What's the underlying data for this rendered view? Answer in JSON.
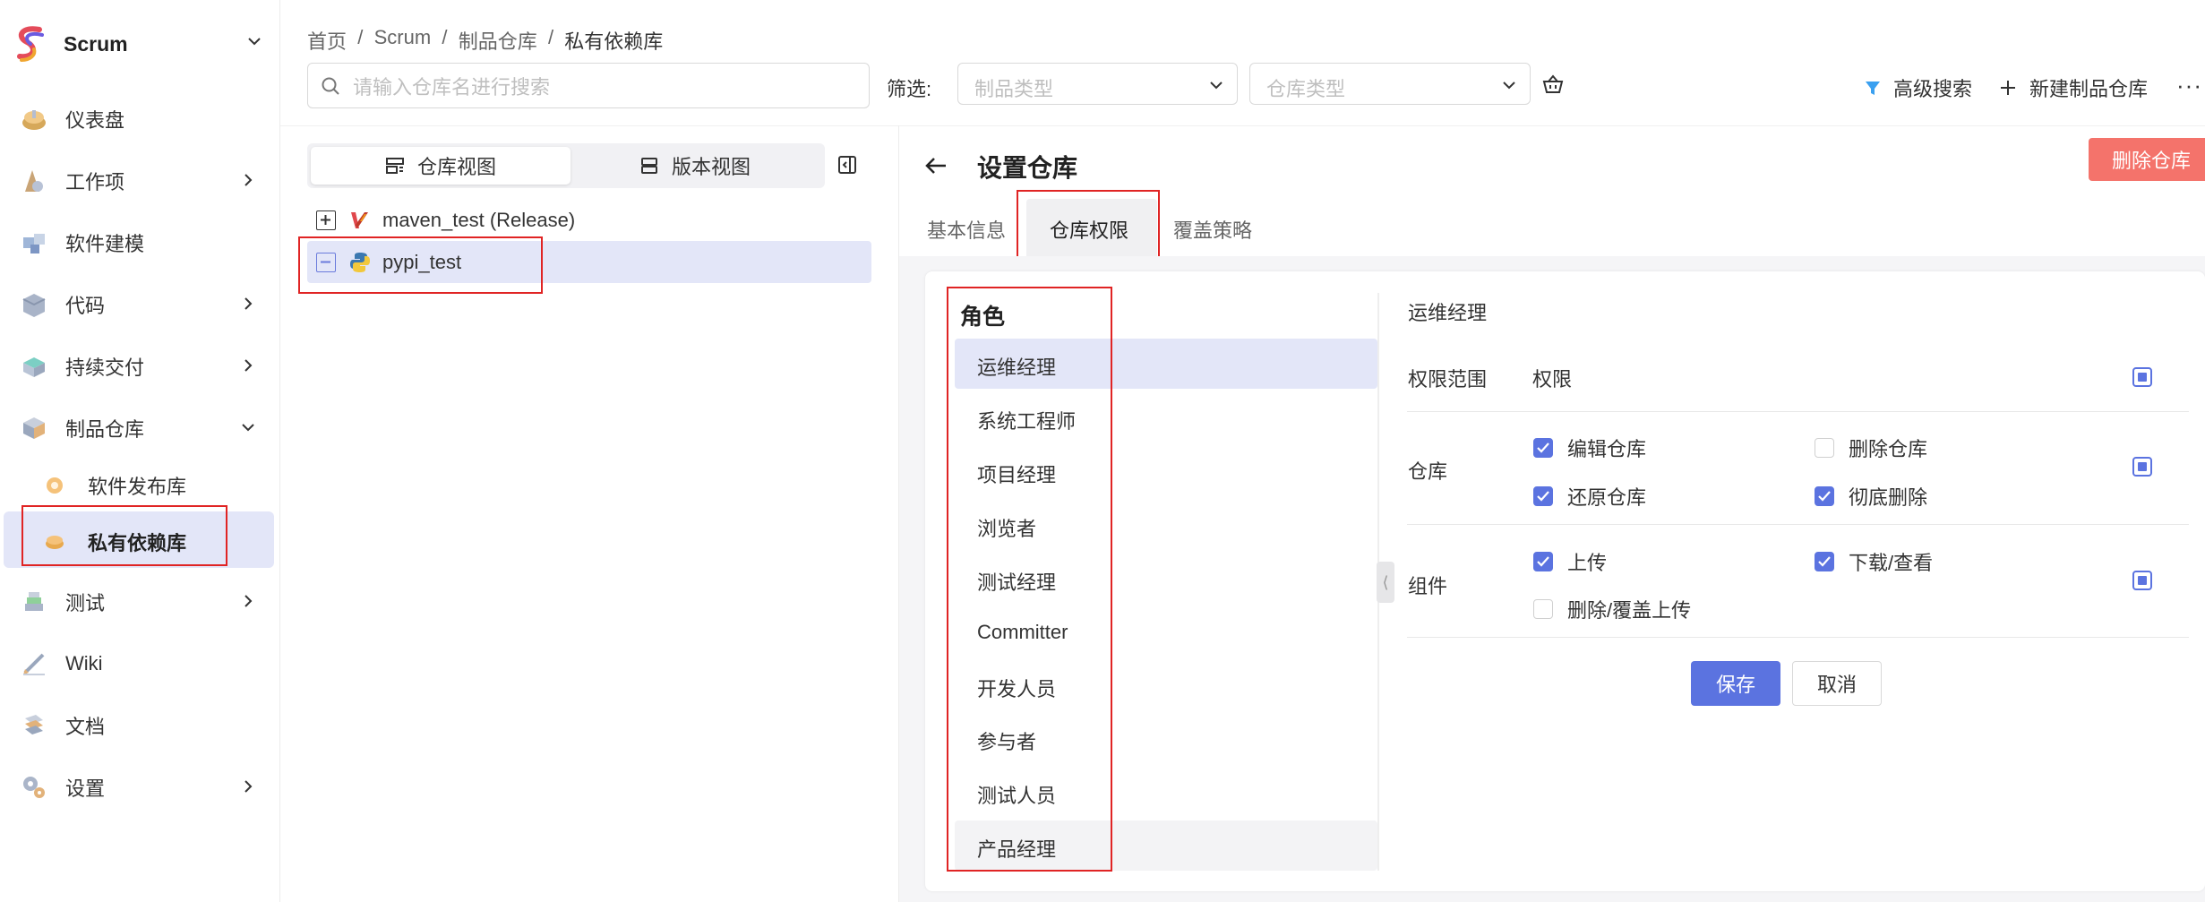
{
  "app": {
    "name": "Scrum"
  },
  "sidebar": {
    "items": [
      {
        "label": "仪表盘",
        "icon": "dashboard-icon"
      },
      {
        "label": "工作项",
        "icon": "workitem-icon"
      },
      {
        "label": "软件建模",
        "icon": "modeling-icon"
      },
      {
        "label": "代码",
        "icon": "code-icon"
      },
      {
        "label": "持续交付",
        "icon": "delivery-icon"
      },
      {
        "label": "制品仓库",
        "icon": "artifact-repo-icon"
      },
      {
        "label": "测试",
        "icon": "test-icon"
      },
      {
        "label": "Wiki",
        "icon": "wiki-icon"
      },
      {
        "label": "文档",
        "icon": "docs-icon"
      },
      {
        "label": "设置",
        "icon": "settings-icon"
      }
    ],
    "subitems": [
      {
        "label": "软件发布库"
      },
      {
        "label": "私有依赖库"
      }
    ]
  },
  "breadcrumb": [
    "首页",
    "Scrum",
    "制品仓库",
    "私有依赖库"
  ],
  "search": {
    "placeholder": "请输入仓库名进行搜索"
  },
  "filter": {
    "label": "筛选:",
    "artifact_type_placeholder": "制品类型",
    "repo_type_placeholder": "仓库类型"
  },
  "toolbar": {
    "advanced_search": "高级搜索",
    "new_repo": "新建制品仓库",
    "more": "···"
  },
  "view_switch": {
    "repo_view": "仓库视图",
    "version_view": "版本视图"
  },
  "tree": {
    "rows": [
      {
        "label": "maven_test (Release)"
      },
      {
        "label": "pypi_test"
      }
    ]
  },
  "detail": {
    "title": "设置仓库",
    "delete_button": "删除仓库",
    "tabs": [
      "基本信息",
      "仓库权限",
      "覆盖策略"
    ],
    "active_tab": "仓库权限"
  },
  "roles": {
    "header": "角色",
    "items": [
      "运维经理",
      "系统工程师",
      "项目经理",
      "浏览者",
      "测试经理",
      "Committer",
      "开发人员",
      "参与者",
      "测试人员",
      "产品经理"
    ],
    "selected": "运维经理"
  },
  "permissions": {
    "role_title": "运维经理",
    "scope_label": "权限范围",
    "perm_label": "权限",
    "groups": [
      {
        "name": "仓库",
        "options": [
          {
            "label": "编辑仓库",
            "checked": true
          },
          {
            "label": "删除仓库",
            "checked": false
          },
          {
            "label": "还原仓库",
            "checked": true
          },
          {
            "label": "彻底删除",
            "checked": true
          }
        ]
      },
      {
        "name": "组件",
        "options": [
          {
            "label": "上传",
            "checked": true
          },
          {
            "label": "下载/查看",
            "checked": true
          },
          {
            "label": "删除/覆盖上传",
            "checked": false
          }
        ]
      }
    ],
    "save": "保存",
    "cancel": "取消"
  },
  "colors": {
    "accent": "#5b73e0",
    "selection_bg": "#e3e6f8",
    "danger": "#f4736b",
    "highlight_box": "#e02424"
  }
}
